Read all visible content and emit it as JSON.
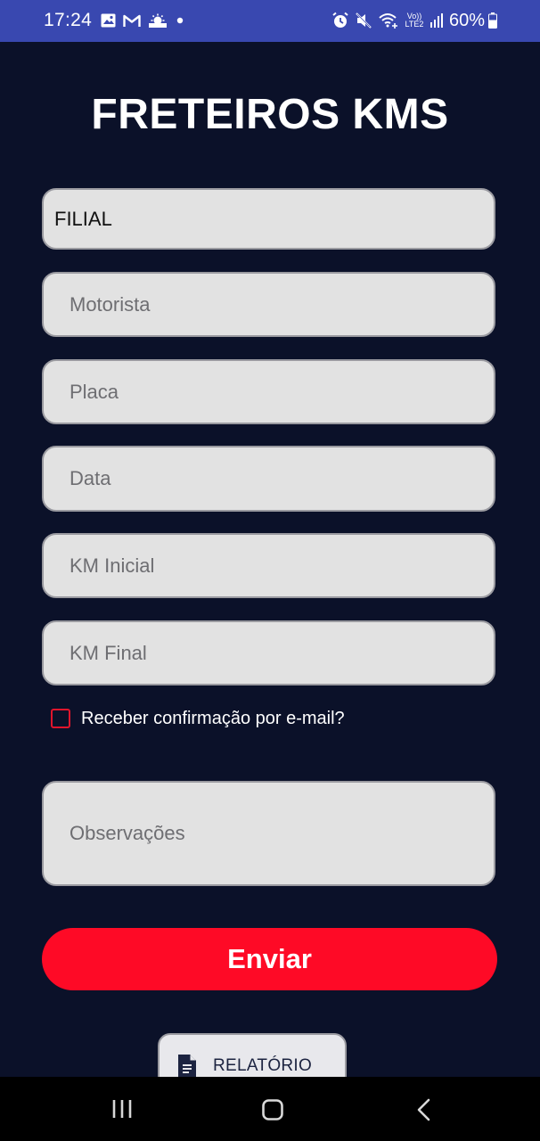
{
  "status_bar": {
    "time": "17:24",
    "left_icons": [
      "gallery-icon",
      "gmail-icon",
      "weather-icon",
      "notification-dot-icon"
    ],
    "right_icons": [
      "alarm-icon",
      "mute-icon",
      "wifi-calling-icon",
      "volte-icon",
      "signal-icon"
    ],
    "volte_label": "Vo)) LTE2",
    "battery": "60%"
  },
  "app": {
    "title": "FRETEIROS KMS"
  },
  "form": {
    "filial": {
      "value": "FILIAL"
    },
    "motorista": {
      "placeholder": "Motorista"
    },
    "placa": {
      "placeholder": "Placa"
    },
    "data": {
      "placeholder": "Data"
    },
    "km_inicial": {
      "placeholder": "KM Inicial"
    },
    "km_final": {
      "placeholder": "KM Final"
    },
    "email_confirm": {
      "label": "Receber confirmação por e-mail?",
      "checked": false
    },
    "observacoes": {
      "placeholder": "Observações"
    },
    "send_label": "Enviar"
  },
  "report_button": {
    "label": "RELATÓRIO",
    "icon": "document-icon"
  },
  "nav_bar": {
    "buttons": [
      "recent-apps-icon",
      "home-icon",
      "back-icon"
    ]
  },
  "colors": {
    "background": "#0b1129",
    "status_bar": "#3948b0",
    "accent_red": "#fe0a26",
    "field_background": "#e2e2e2"
  }
}
